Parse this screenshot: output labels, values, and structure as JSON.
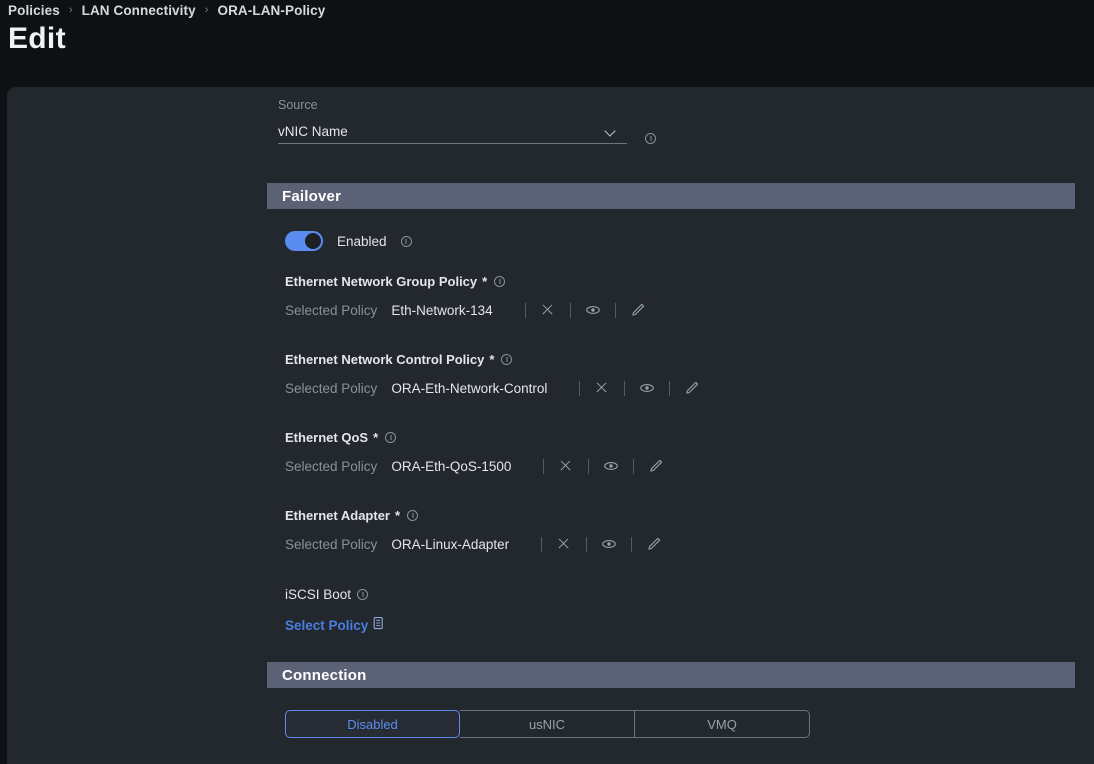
{
  "header": {
    "breadcrumb": [
      {
        "label": "Policies"
      },
      {
        "label": "LAN Connectivity"
      },
      {
        "label": "ORA-LAN-Policy"
      }
    ],
    "separator": "›",
    "title": "Edit"
  },
  "form": {
    "source": {
      "label": "Source",
      "value": "vNIC Name",
      "chevron_icon": "chevron-down-icon",
      "info_icon": "info-icon"
    }
  },
  "failover": {
    "section_title": "Failover",
    "toggle": {
      "label": "Enabled",
      "state": "on",
      "info_icon": "info-icon"
    },
    "policies": [
      {
        "title": "Ethernet Network Group Policy",
        "required": "*",
        "selected_label": "Selected Policy",
        "selected_value": "Eth-Network-134",
        "actions": [
          "clear-icon",
          "view-icon",
          "edit-icon"
        ]
      },
      {
        "title": "Ethernet Network Control Policy",
        "required": "*",
        "selected_label": "Selected Policy",
        "selected_value": "ORA-Eth-Network-Control",
        "actions": [
          "clear-icon",
          "view-icon",
          "edit-icon"
        ]
      },
      {
        "title": "Ethernet QoS",
        "required": "*",
        "selected_label": "Selected Policy",
        "selected_value": "ORA-Eth-QoS-1500",
        "actions": [
          "clear-icon",
          "view-icon",
          "edit-icon"
        ]
      },
      {
        "title": "Ethernet Adapter",
        "required": "*",
        "selected_label": "Selected Policy",
        "selected_value": "ORA-Linux-Adapter",
        "actions": [
          "clear-icon",
          "view-icon",
          "edit-icon"
        ]
      }
    ],
    "iscsi": {
      "title": "iSCSI Boot",
      "link_label": "Select Policy",
      "link_icon": "document-list-icon"
    }
  },
  "connection": {
    "section_title": "Connection",
    "tabs": [
      {
        "label": "Disabled",
        "active": true
      },
      {
        "label": "usNIC",
        "active": false
      },
      {
        "label": "VMQ",
        "active": false
      }
    ]
  },
  "colors": {
    "page_background": "#0e1114",
    "panel_background": "#23272e",
    "section_bar": "#5c6275",
    "accent_blue": "#5a8cf0",
    "link_blue": "#4a7fe0",
    "text_primary": "#e3e6ea",
    "text_muted": "#8b919b"
  }
}
